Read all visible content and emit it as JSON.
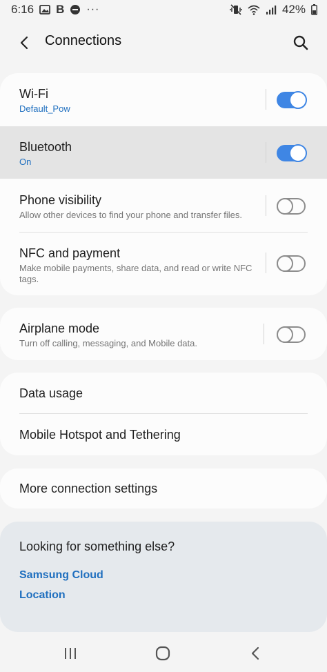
{
  "status_bar": {
    "time": "6:16",
    "bold_b": "B",
    "more_dots": "···",
    "battery": "42%"
  },
  "header": {
    "title": "Connections"
  },
  "connections": [
    {
      "title": "Wi-Fi",
      "subtitle": "Default_Pow",
      "toggle": "on"
    },
    {
      "title": "Bluetooth",
      "subtitle": "On",
      "toggle": "on"
    },
    {
      "title": "Phone visibility",
      "subtitle": "Allow other devices to find your phone and transfer files.",
      "toggle": "off"
    },
    {
      "title": "NFC and payment",
      "subtitle": "Make mobile payments, share data, and read or write NFC tags.",
      "toggle": "off"
    }
  ],
  "airplane": {
    "title": "Airplane mode",
    "subtitle": "Turn off calling, messaging, and Mobile data.",
    "toggle": "off"
  },
  "data_group": [
    {
      "title": "Data usage"
    },
    {
      "title": "Mobile Hotspot and Tethering"
    }
  ],
  "more_settings": {
    "title": "More connection settings"
  },
  "suggestions": {
    "title": "Looking for something else?",
    "links": [
      "Samsung Cloud",
      "Location"
    ]
  },
  "colors": {
    "accent": "#3f86e4",
    "link": "#1f6fbf",
    "background": "#f4f4f4"
  }
}
